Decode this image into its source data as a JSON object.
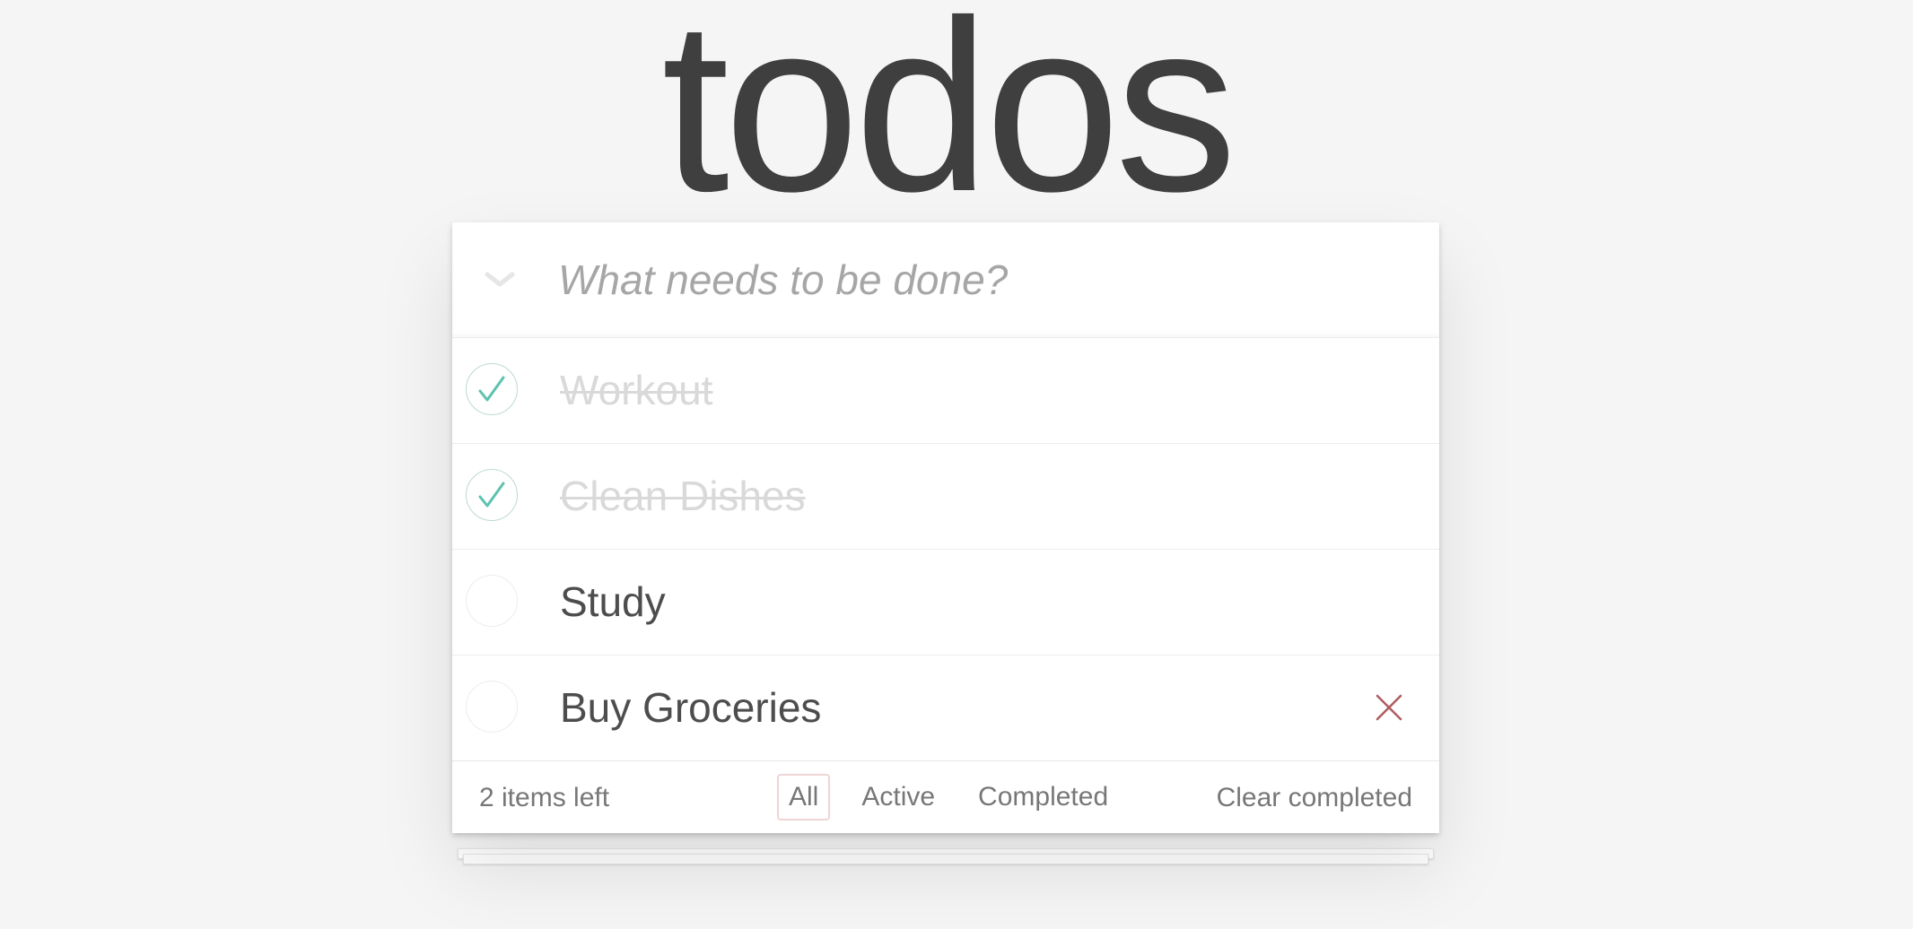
{
  "app": {
    "title": "todos"
  },
  "new_todo": {
    "placeholder": "What needs to be done?"
  },
  "todos": [
    {
      "label": "Workout",
      "completed": true
    },
    {
      "label": "Clean Dishes",
      "completed": true
    },
    {
      "label": "Study",
      "completed": false
    },
    {
      "label": "Buy Groceries",
      "completed": false
    }
  ],
  "footer": {
    "count_text": "2 items left",
    "filters": [
      {
        "label": "All",
        "selected": true
      },
      {
        "label": "Active",
        "selected": false
      },
      {
        "label": "Completed",
        "selected": false
      }
    ],
    "clear_completed_label": "Clear completed"
  },
  "colors": {
    "background": "#f5f5f5",
    "check": "#5dc2af",
    "destroy": "#af5b5e",
    "selected_filter_border": "#efd5d5"
  },
  "icons": {
    "toggle_all": "chevron-down-icon",
    "check": "check-icon",
    "destroy": "close-icon"
  }
}
